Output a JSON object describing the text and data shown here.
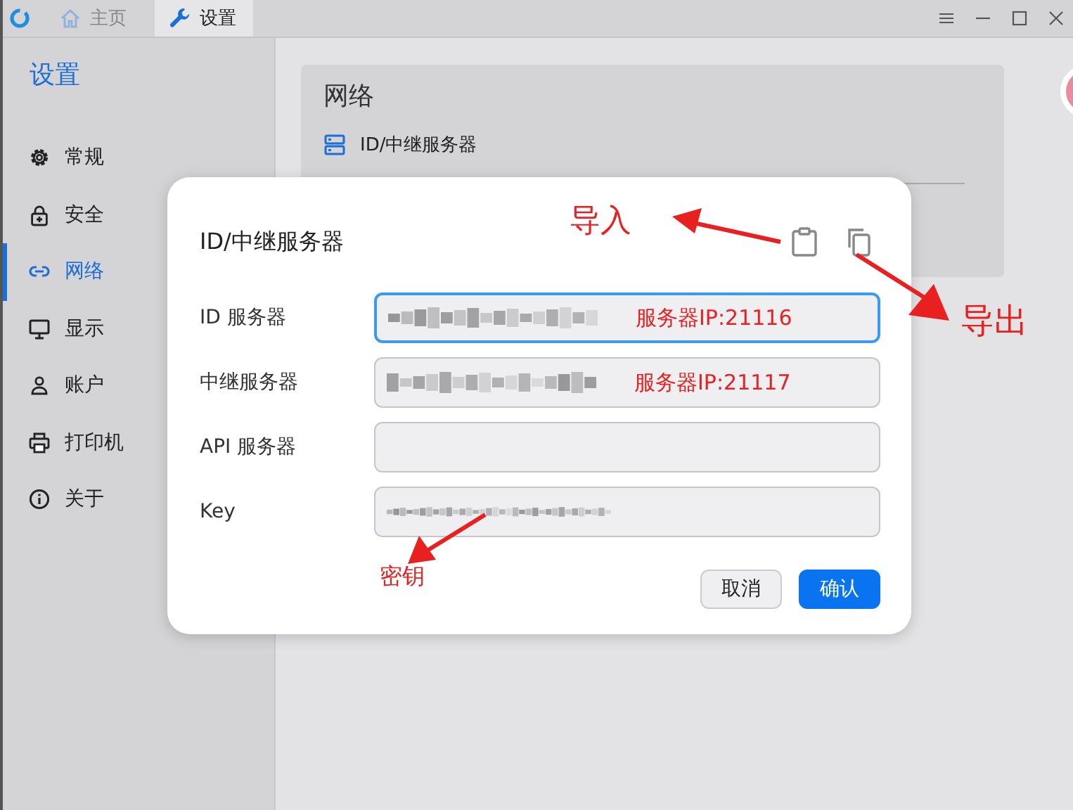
{
  "tabs": [
    {
      "label": "主页",
      "selected": false
    },
    {
      "label": "设置",
      "selected": true
    }
  ],
  "sidebar": {
    "title": "设置",
    "items": [
      {
        "label": "常规",
        "selected": false
      },
      {
        "label": "安全",
        "selected": false
      },
      {
        "label": "网络",
        "selected": true
      },
      {
        "label": "显示",
        "selected": false
      },
      {
        "label": "账户",
        "selected": false
      },
      {
        "label": "打印机",
        "selected": false
      },
      {
        "label": "关于",
        "selected": false
      }
    ]
  },
  "section": {
    "title": "网络",
    "items": [
      {
        "label": "ID/中继服务器"
      }
    ]
  },
  "dialog": {
    "title": "ID/中继服务器",
    "fields": [
      {
        "label": "ID 服务器",
        "focused": true,
        "blurred": true,
        "note": "服务器IP:21116"
      },
      {
        "label": "中继服务器",
        "focused": false,
        "blurred": true,
        "note": "服务器IP:21117"
      },
      {
        "label": "API 服务器",
        "focused": false,
        "blurred": false
      },
      {
        "label": "Key",
        "focused": false,
        "blurred": true
      }
    ],
    "buttons": [
      {
        "label": "取消",
        "kind": "secondary"
      },
      {
        "label": "确认",
        "kind": "primary"
      }
    ]
  },
  "annotations": [
    {
      "text": "导入",
      "kind": "import"
    },
    {
      "text": "导出",
      "kind": "export"
    },
    {
      "text": "密钥",
      "kind": "key"
    }
  ]
}
